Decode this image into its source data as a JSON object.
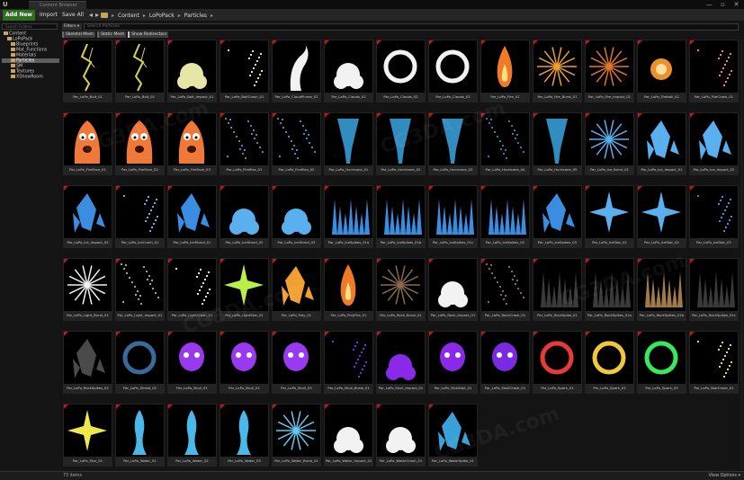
{
  "window": {
    "tab_title": "Content Browser",
    "minimize": "—",
    "maximize": "▫",
    "close": "✕"
  },
  "toolbar": {
    "add_new": "Add New ▾",
    "import": "Import",
    "save_all": "Save All",
    "back": "◂",
    "forward": "▸",
    "history": "▾"
  },
  "breadcrumb": [
    "Content",
    "LoPoPack",
    "Particles"
  ],
  "search": {
    "paths_placeholder": "Search Folders",
    "assets_placeholder": "Search Particles",
    "filters_label": "Filters ▾"
  },
  "filter_chips": [
    "Skeletal Mesh",
    "Static Mesh",
    "Show Redirectors"
  ],
  "tree": [
    {
      "label": "Content",
      "depth": 0,
      "selected": false
    },
    {
      "label": "LoPoPack",
      "depth": 1,
      "selected": false
    },
    {
      "label": "Blueprints",
      "depth": 2,
      "selected": false
    },
    {
      "label": "Mat_Functions",
      "depth": 2,
      "selected": false
    },
    {
      "label": "Materials",
      "depth": 2,
      "selected": false
    },
    {
      "label": "Particles",
      "depth": 2,
      "selected": true
    },
    {
      "label": "SM",
      "depth": 2,
      "selected": false
    },
    {
      "label": "Textures",
      "depth": 2,
      "selected": false
    },
    {
      "label": "XShowRoom",
      "depth": 2,
      "selected": false
    }
  ],
  "assets": [
    {
      "label": "Par_LoPo_Bolt_01",
      "color": "#d9d24a",
      "glyph": "bolt"
    },
    {
      "label": "Par_LoPo_Bolt_02",
      "color": "#d9d24a",
      "glyph": "bolt"
    },
    {
      "label": "Par_LoPo_Bolt_Impact_01",
      "color": "#e6e6a8",
      "glyph": "blob"
    },
    {
      "label": "Par_LoPo_BoltCrash_01",
      "color": "#e6e67a",
      "glyph": "spark"
    },
    {
      "label": "Par_LoPo_CloudPlume_01",
      "color": "#f2f2f2",
      "glyph": "plume"
    },
    {
      "label": "Par_LoPo_Clouds_01",
      "color": "#f2f2f2",
      "glyph": "blob"
    },
    {
      "label": "Par_LoPo_Clouds_02",
      "color": "#f2f2f2",
      "glyph": "ring"
    },
    {
      "label": "Par_LoPo_Clouds_03",
      "color": "#f2f2f2",
      "glyph": "ring"
    },
    {
      "label": "Par_LoPo_Fire_01",
      "color": "#f07a28",
      "glyph": "flame"
    },
    {
      "label": "Par_LoPo_Fire_Burst_01",
      "color": "#f0a030",
      "glyph": "burst"
    },
    {
      "label": "Par_LoPo_Fire_Impact_01",
      "color": "#e0782a",
      "glyph": "burst"
    },
    {
      "label": "Par_LoPo_Fireball_01",
      "color": "#f0902a",
      "glyph": "orb"
    },
    {
      "label": "Par_LoPo_FireCrash_01",
      "color": "#f08a2a",
      "glyph": "spark"
    },
    {
      "label": "Par_LoPo_FireFace_01",
      "color": "#f07838",
      "glyph": "face"
    },
    {
      "label": "Par_LoPo_FireFace_02",
      "color": "#f07838",
      "glyph": "face"
    },
    {
      "label": "Par_LoPo_FireFace_03",
      "color": "#f07838",
      "glyph": "face"
    },
    {
      "label": "Par_LoPo_Fireflies_01",
      "color": "#58b8e8",
      "glyph": "dots"
    },
    {
      "label": "Par_LoPo_Fireflies_02",
      "color": "#58b8e8",
      "glyph": "dots"
    },
    {
      "label": "Par_LoPo_Hurricane_01",
      "color": "#3aa6e0",
      "glyph": "funnel"
    },
    {
      "label": "Par_LoPo_Hurricane_02",
      "color": "#3aa6e0",
      "glyph": "funnel"
    },
    {
      "label": "Par_LoPo_Hurricane_03",
      "color": "#3aa6e0",
      "glyph": "funnel"
    },
    {
      "label": "Par_LoPo_Hurricane_04",
      "color": "#3aa6e0",
      "glyph": "dots"
    },
    {
      "label": "Par_LoPo_Hurricane_05",
      "color": "#3aa6e0",
      "glyph": "funnel"
    },
    {
      "label": "Par_LoPo_Ice_Burst_01",
      "color": "#5ab0ee",
      "glyph": "burst"
    },
    {
      "label": "Par_LoPo_Ice_Impact_01",
      "color": "#5ab0ee",
      "glyph": "shard"
    },
    {
      "label": "Par_LoPo_Ice_Impact_02",
      "color": "#5ab0ee",
      "glyph": "shard"
    },
    {
      "label": "Par_LoPo_Ice_Impact_03",
      "color": "#3a8de0",
      "glyph": "shard"
    },
    {
      "label": "Par_LoPo_IceCrash_01",
      "color": "#5ab0ee",
      "glyph": "spark"
    },
    {
      "label": "Par_LoPo_IceShard_01",
      "color": "#3a8de0",
      "glyph": "shard"
    },
    {
      "label": "Par_LoPo_IceShard_02",
      "color": "#5ab0ee",
      "glyph": "blob"
    },
    {
      "label": "Par_LoPo_IceShard_03",
      "color": "#5ab0ee",
      "glyph": "blob"
    },
    {
      "label": "Par_LoPo_IceSpikes_01a",
      "color": "#3a8de0",
      "glyph": "spikes"
    },
    {
      "label": "Par_LoPo_IceSpikes_01b",
      "color": "#3a8de0",
      "glyph": "spikes"
    },
    {
      "label": "Par_LoPo_IceSpikes_01c",
      "color": "#3a8de0",
      "glyph": "spikes"
    },
    {
      "label": "Par_LoPo_IceSpikes_02",
      "color": "#3a8de0",
      "glyph": "spikes"
    },
    {
      "label": "Par_LoPo_IceSpikes_03",
      "color": "#3a8de0",
      "glyph": "shard"
    },
    {
      "label": "Par_LoPo_IceStar_01",
      "color": "#5ab0ee",
      "glyph": "star"
    },
    {
      "label": "Par_LoPo_IceStar_02",
      "color": "#5ab0ee",
      "glyph": "star"
    },
    {
      "label": "Par_LoPo_IceStar_03",
      "color": "#3a8de0",
      "glyph": "spark"
    },
    {
      "label": "Par_LoPo_Light_Burst_01",
      "color": "#f2f2f2",
      "glyph": "burst"
    },
    {
      "label": "Par_LoPo_Light_Impact_01",
      "color": "#c8e878",
      "glyph": "dots"
    },
    {
      "label": "Par_LoPo_LightCrash_01",
      "color": "#e8e8c8",
      "glyph": "spark"
    },
    {
      "label": "Par_LoPo_LightStar_01",
      "color": "#b8f048",
      "glyph": "star"
    },
    {
      "label": "Par_LoPo_Poly_01",
      "color": "#f0a030",
      "glyph": "shard"
    },
    {
      "label": "Par_LoPo_PolyFire_01",
      "color": "#f07a28",
      "glyph": "flame"
    },
    {
      "label": "Par_LoPo_Rock_Burst_01",
      "color": "#8a6a4a",
      "glyph": "burst"
    },
    {
      "label": "Par_LoPo_Rock_Impact_01",
      "color": "#f2f2f2",
      "glyph": "blob"
    },
    {
      "label": "Par_LoPo_RockCrash_01",
      "color": "#c88a3a",
      "glyph": "dots"
    },
    {
      "label": "Par_LoPo_RockSpike_01",
      "color": "#3a3a3a",
      "glyph": "spikes"
    },
    {
      "label": "Par_LoPo_RockSpikes_01a",
      "color": "#3a3a3a",
      "glyph": "spikes"
    },
    {
      "label": "Par_LoPo_RockSpikes_01b",
      "color": "#a07a4a",
      "glyph": "spikes"
    },
    {
      "label": "Par_LoPo_RockSpikes_01c",
      "color": "#3a3a3a",
      "glyph": "spikes"
    },
    {
      "label": "Par_LoPo_RockSpikes_02",
      "color": "#4a4a4a",
      "glyph": "shard"
    },
    {
      "label": "Par_LoPo_Shield_01",
      "color": "#3a6a9a",
      "glyph": "ring"
    },
    {
      "label": "Par_LoPo_Skull_01",
      "color": "#9a3af0",
      "glyph": "skull"
    },
    {
      "label": "Par_LoPo_Skull_02",
      "color": "#9a3af0",
      "glyph": "skull"
    },
    {
      "label": "Par_LoPo_Skull_03",
      "color": "#9a3af0",
      "glyph": "skull"
    },
    {
      "label": "Par_LoPo_Skull_Burst_01",
      "color": "#7a2ae0",
      "glyph": "spark"
    },
    {
      "label": "Par_LoPo_Skull_Impact_01",
      "color": "#8a2ae8",
      "glyph": "blob"
    },
    {
      "label": "Par_LoPo_SkullBolt_01",
      "color": "#8a2ae8",
      "glyph": "skull"
    },
    {
      "label": "Par_LoPo_SkullCrash_01",
      "color": "#7a2ae0",
      "glyph": "skull"
    },
    {
      "label": "Par_LoPo_Spark_01",
      "color": "#e83a3a",
      "glyph": "ring"
    },
    {
      "label": "Par_LoPo_Spark_02",
      "color": "#f0c83a",
      "glyph": "ring"
    },
    {
      "label": "Par_LoPo_Spark_03",
      "color": "#3ae85a",
      "glyph": "ring"
    },
    {
      "label": "Par_LoPo_StarCrash_01",
      "color": "#f0d83a",
      "glyph": "spark"
    },
    {
      "label": "Par_LoPo_Star_01",
      "color": "#f0e84a",
      "glyph": "star"
    },
    {
      "label": "Par_LoPo_Water_01",
      "color": "#4ab8e8",
      "glyph": "drop"
    },
    {
      "label": "Par_LoPo_Water_02",
      "color": "#4ab8e8",
      "glyph": "drop"
    },
    {
      "label": "Par_LoPo_Water_03",
      "color": "#4ab8e8",
      "glyph": "drop"
    },
    {
      "label": "Par_LoPo_Water_Burst_01",
      "color": "#6ac8f0",
      "glyph": "burst"
    },
    {
      "label": "Par_LoPo_Water_Impact_01",
      "color": "#f2f2f2",
      "glyph": "blob"
    },
    {
      "label": "Par_LoPo_WaterCrash_01",
      "color": "#f2f2f2",
      "glyph": "blob"
    },
    {
      "label": "Par_LoPo_WaterSpike_01",
      "color": "#3aa0d8",
      "glyph": "shard"
    }
  ],
  "status": {
    "count": "73 items",
    "view_options": "View Options ▾"
  },
  "watermark": "CG3DA.com"
}
